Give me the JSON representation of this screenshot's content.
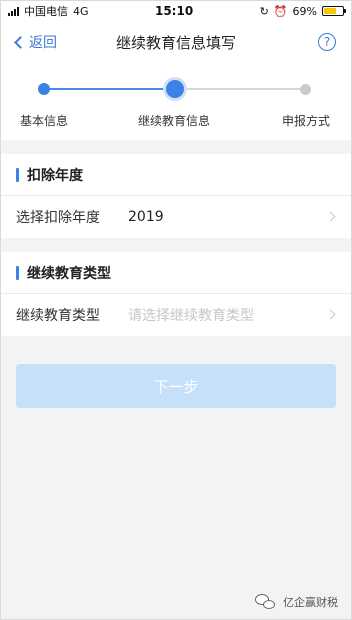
{
  "status_bar": {
    "carrier": "中国电信",
    "network": "4G",
    "time": "15:10",
    "battery_percent": "69%",
    "battery_level": 0.69
  },
  "nav": {
    "back_label": "返回",
    "title": "继续教育信息填写",
    "help_symbol": "?"
  },
  "stepper": {
    "steps": [
      {
        "label": "基本信息",
        "state": "done"
      },
      {
        "label": "继续教育信息",
        "state": "current"
      },
      {
        "label": "申报方式",
        "state": "todo"
      }
    ]
  },
  "sections": [
    {
      "title": "扣除年度",
      "row": {
        "label": "选择扣除年度",
        "value": "2019",
        "placeholder": ""
      }
    },
    {
      "title": "继续教育类型",
      "row": {
        "label": "继续教育类型",
        "value": "",
        "placeholder": "请选择继续教育类型"
      }
    }
  ],
  "next_button": {
    "label": "下一步"
  },
  "watermark": {
    "text": "亿企赢财税"
  },
  "colors": {
    "accent": "#3b82e6",
    "button_disabled": "#c7e0fa"
  }
}
